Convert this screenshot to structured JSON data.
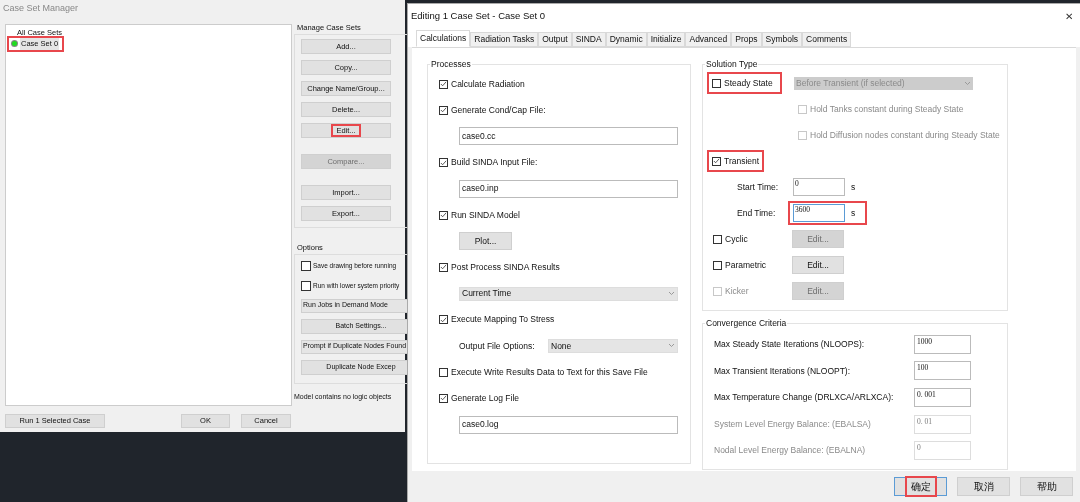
{
  "manager": {
    "title": "Case Set Manager",
    "tree": {
      "label": "All Case Sets",
      "children": [
        {
          "label": "Case Set 0",
          "color": "#22dd22",
          "highlighted": true
        }
      ]
    },
    "manage_group": {
      "title": "Manage Case Sets",
      "button_groups": [
        [
          {
            "label": "Add...",
            "disabled": false,
            "highlighted": false
          },
          {
            "label": "Copy...",
            "disabled": false,
            "highlighted": false
          },
          {
            "label": "Change Name/Group...",
            "disabled": false,
            "highlighted": false
          },
          {
            "label": "Delete...",
            "disabled": false,
            "highlighted": false
          },
          {
            "label": "Edit...",
            "disabled": false,
            "highlighted": true
          }
        ],
        [
          {
            "label": "Compare...",
            "disabled": true,
            "highlighted": false
          }
        ],
        [
          {
            "label": "Import...",
            "disabled": false,
            "highlighted": false
          },
          {
            "label": "Export...",
            "disabled": false,
            "highlighted": false
          }
        ]
      ]
    },
    "options_group": {
      "title": "Options",
      "items": [
        {
          "kind": "checkbox",
          "label": "Save drawing before running",
          "checked": false
        },
        {
          "kind": "checkbox",
          "label": "Run with lower system priority",
          "checked": false
        },
        {
          "kind": "select",
          "label": "Run Jobs in Demand Mode"
        },
        {
          "kind": "button",
          "label": "Batch Settings..."
        },
        {
          "kind": "select",
          "label": "Prompt if Duplicate Nodes Found"
        },
        {
          "kind": "button",
          "label": "Duplicate Node Excep"
        }
      ]
    },
    "status": "Model contains no logic objects",
    "run_button": "Run 1 Selected Case",
    "ok_button": "OK",
    "cancel_button": "Cancel"
  },
  "dialog": {
    "title": "Editing 1 Case Set - Case Set 0",
    "close": "✕",
    "tabs": [
      {
        "label": "Calculations",
        "selected": true
      },
      {
        "label": "Radiation Tasks",
        "selected": false
      },
      {
        "label": "Output",
        "selected": false
      },
      {
        "label": "SINDA",
        "selected": false
      },
      {
        "label": "Dynamic",
        "selected": false
      },
      {
        "label": "Initialize",
        "selected": false
      },
      {
        "label": "Advanced",
        "selected": false
      },
      {
        "label": "Props",
        "selected": false
      },
      {
        "label": "Symbols",
        "selected": false
      },
      {
        "label": "Comments",
        "selected": false
      }
    ],
    "processes": {
      "title": "Processes",
      "items": [
        {
          "kind": "checkbox",
          "label": "Calculate Radiation",
          "checked": true
        },
        {
          "kind": "checkbox",
          "label": "Generate Cond/Cap File:",
          "checked": true
        },
        {
          "kind": "field",
          "value": "case0.cc"
        },
        {
          "kind": "checkbox",
          "label": "Build SINDA Input File:",
          "checked": true
        },
        {
          "kind": "field",
          "value": "case0.inp"
        },
        {
          "kind": "checkbox",
          "label": "Run SINDA Model",
          "checked": true
        },
        {
          "kind": "button",
          "label": "Plot..."
        },
        {
          "kind": "checkbox",
          "label": "Post Process SINDA Results",
          "checked": true
        },
        {
          "kind": "select",
          "value": "Current Time"
        },
        {
          "kind": "checkbox",
          "label": "Execute Mapping To Stress",
          "checked": true
        },
        {
          "kind": "labeled_select",
          "label": "Output File Options:",
          "value": "None"
        },
        {
          "kind": "checkbox",
          "label": "Execute Write Results Data to Text for this Save File",
          "checked": false
        },
        {
          "kind": "checkbox",
          "label": "Generate Log File",
          "checked": true
        },
        {
          "kind": "field",
          "value": "case0.log"
        }
      ]
    },
    "solution": {
      "title": "Solution Type",
      "items": [
        {
          "kind": "checkbox_select",
          "label": "Steady State",
          "checked": false,
          "highlighted": true,
          "value": "Before Transient (if selected)"
        },
        {
          "kind": "sub_checkbox",
          "label": "Hold Tanks constant during Steady State",
          "checked": false,
          "disabled": true
        },
        {
          "kind": "sub_checkbox",
          "label": "Hold Diffusion nodes constant during Steady State",
          "checked": false,
          "disabled": true
        },
        {
          "kind": "checkbox",
          "label": "Transient",
          "checked": true,
          "highlighted": true
        },
        {
          "kind": "time",
          "label": "Start Time:",
          "value": "0",
          "unit": "s",
          "highlighted": false
        },
        {
          "kind": "time",
          "label": "End Time:",
          "value": "3600",
          "unit": "s",
          "highlighted": true
        },
        {
          "kind": "checkbox_button",
          "label": "Cyclic",
          "checked": false,
          "disabled": false,
          "button": "Edit...",
          "button_disabled": true
        },
        {
          "kind": "checkbox_button",
          "label": "Parametric",
          "checked": false,
          "disabled": false,
          "button": "Edit...",
          "button_disabled": false
        },
        {
          "kind": "checkbox_button",
          "label": "Kicker",
          "checked": false,
          "disabled": true,
          "button": "Edit...",
          "button_disabled": true
        }
      ]
    },
    "convergence": {
      "title": "Convergence Criteria",
      "items": [
        {
          "label": "Max Steady State Iterations (NLOOPS):",
          "value": "1000",
          "disabled": false
        },
        {
          "label": "Max Transient Iterations (NLOOPT):",
          "value": "100",
          "disabled": false
        },
        {
          "label": "Max Temperature Change (DRLXCA/ARLXCA):",
          "value": "0. 001",
          "disabled": false
        },
        {
          "label": "System Level Energy Balance: (EBALSA)",
          "value": "0. 01",
          "disabled": true
        },
        {
          "label": "Nodal Level Energy Balance: (EBALNA)",
          "value": "0",
          "disabled": true
        }
      ]
    },
    "buttons": [
      {
        "label": "确定",
        "highlighted": true
      },
      {
        "label": "取消",
        "highlighted": false
      },
      {
        "label": "帮助",
        "highlighted": false
      }
    ]
  }
}
